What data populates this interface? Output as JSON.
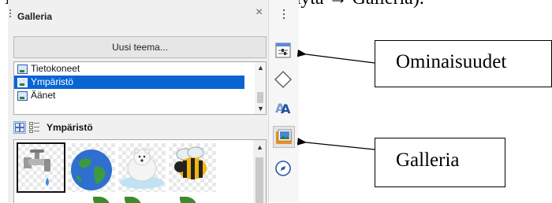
{
  "doc_text": "Huom. Galleriassa vaihtoina kuvia (Näytä → Galleria).",
  "panel": {
    "title": "Galleria",
    "close_glyph": "×",
    "new_theme_label": "Uusi teema...",
    "themes": [
      {
        "label": "Tietokoneet",
        "selected": false
      },
      {
        "label": "Ympäristö",
        "selected": true
      },
      {
        "label": "Äänet",
        "selected": false
      }
    ],
    "current_theme": "Ympäristö",
    "view_modes": [
      "icon-view",
      "detail-view"
    ],
    "thumbnails": [
      "faucet-with-water-drop",
      "earth-globe",
      "polar-bear-on-ice",
      "bee",
      "green-leaves"
    ]
  },
  "sidebar_deck": {
    "buttons": [
      {
        "name": "properties-icon",
        "active": false
      },
      {
        "name": "styles-diamond-icon",
        "active": false
      },
      {
        "name": "fontwork-icon",
        "active": false
      },
      {
        "name": "gallery-icon",
        "active": true
      },
      {
        "name": "navigator-icon",
        "active": false
      }
    ]
  },
  "callouts": {
    "properties": "Ominaisuudet",
    "gallery": "Galleria"
  },
  "colors": {
    "selection": "#0a64d4",
    "panel_bg": "#f0f0f0",
    "gallery_icon_orange": "#f08c1c"
  }
}
